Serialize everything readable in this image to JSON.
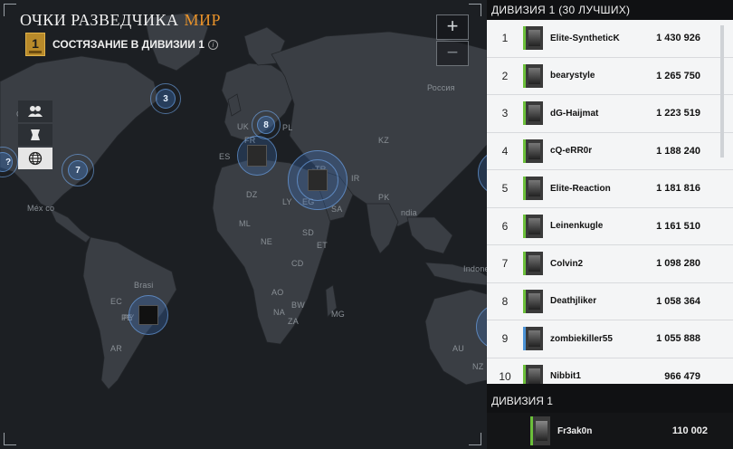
{
  "header": {
    "title": "ОЧКИ РАЗВЕДЧИКА",
    "title_accent": "МИР",
    "rank_number": "1",
    "subtitle": "СОСТЯЗАНИЕ В ДИВИЗИИ 1",
    "info_glyph": "i"
  },
  "zoom": {
    "in_label": "+",
    "out_label": "−"
  },
  "map_labels": {
    "russia": "Россия",
    "canada": "Са",
    "mexico": "Méx co",
    "brazil": "Brasi",
    "india": "ndia",
    "indonesia": "Indonesia",
    "uk": "UK",
    "pl": "PL",
    "kz": "KZ",
    "tr": "TR",
    "dz": "DZ",
    "ly": "LY",
    "eg": "EG",
    "sa": "SA",
    "ir": "IR",
    "pk": "PK",
    "ml": "ML",
    "ne": "NE",
    "sd": "SD",
    "et": "ET",
    "cd": "CD",
    "ao": "AO",
    "za": "ZA",
    "na": "NA",
    "bw": "BW",
    "ec": "EC",
    "pe": "PE",
    "ar": "AR",
    "py": "PY",
    "mg": "MG",
    "au": "AU",
    "nz": "NZ",
    "es": "ES",
    "fr": "FR"
  },
  "pins": {
    "p1": "3",
    "p2": "8",
    "p3": "7",
    "p4": "?"
  },
  "leaderboard": {
    "title": "ДИВИЗИЯ 1 (30 ЛУЧШИХ)",
    "rows": [
      {
        "rank": "1",
        "name": "Elite-SyntheticK",
        "score": "1 430 926"
      },
      {
        "rank": "2",
        "name": "bearystyle",
        "score": "1 265 750"
      },
      {
        "rank": "3",
        "name": "dG-Haijmat",
        "score": "1 223 519"
      },
      {
        "rank": "4",
        "name": "cQ-eRR0r",
        "score": "1 188 240"
      },
      {
        "rank": "5",
        "name": "Elite-Reaction",
        "score": "1 181 816"
      },
      {
        "rank": "6",
        "name": "Leinenkugle",
        "score": "1 161 510"
      },
      {
        "rank": "7",
        "name": "Colvin2",
        "score": "1 098 280"
      },
      {
        "rank": "8",
        "name": "Deathjliker",
        "score": "1 058 364"
      },
      {
        "rank": "9",
        "name": "zombiekiller55",
        "score": "1 055 888"
      },
      {
        "rank": "10",
        "name": "Nibbit1",
        "score": "966 479"
      }
    ]
  },
  "division": {
    "title": "ДИВИЗИЯ 1",
    "me": {
      "name": "Fr3ak0n",
      "score": "110 002"
    }
  }
}
